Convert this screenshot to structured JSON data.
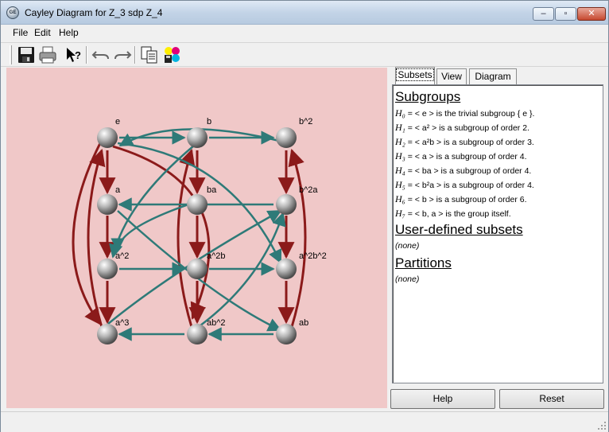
{
  "window": {
    "title": "Cayley Diagram for Z_3 sdp Z_4"
  },
  "menu": {
    "file": "File",
    "edit": "Edit",
    "help": "Help"
  },
  "toolbar": [
    "save-icon",
    "print-icon",
    "whats-this-icon",
    "undo-icon",
    "redo-icon",
    "copy-icon",
    "color-icon"
  ],
  "diagram": {
    "nodes": [
      {
        "id": "e",
        "label": "e"
      },
      {
        "id": "b",
        "label": "b"
      },
      {
        "id": "b2",
        "label": "b^2"
      },
      {
        "id": "a",
        "label": "a"
      },
      {
        "id": "ba",
        "label": "ba"
      },
      {
        "id": "b2a",
        "label": "b^2a"
      },
      {
        "id": "a2",
        "label": "a^2"
      },
      {
        "id": "a2b",
        "label": "a^2b"
      },
      {
        "id": "a2b2",
        "label": "a^2b^2"
      },
      {
        "id": "a3",
        "label": "a^3"
      },
      {
        "id": "ab2",
        "label": "ab^2"
      },
      {
        "id": "ab",
        "label": "ab"
      }
    ],
    "colors": {
      "a_arrows": "#8b1a1a",
      "b_arrows": "#2e7a78",
      "background": "#f0c8c8"
    }
  },
  "tabs": {
    "subsets": "Subsets",
    "view": "View",
    "diagram": "Diagram"
  },
  "panel": {
    "subgroups_heading": "Subgroups",
    "subgroups": [
      {
        "name": "H₀",
        "text": " = < e > is the trivial subgroup { e }."
      },
      {
        "name": "H₁",
        "text": " = < a² > is a subgroup of order 2."
      },
      {
        "name": "H₂",
        "text": " = < a²b > is a subgroup of order 3."
      },
      {
        "name": "H₃",
        "text": " = < a > is a subgroup of order 4."
      },
      {
        "name": "H₄",
        "text": " = < ba > is a subgroup of order 4."
      },
      {
        "name": "H₅",
        "text": " = < b²a > is a subgroup of order 4."
      },
      {
        "name": "H₆",
        "text": " = < b > is a subgroup of order 6."
      },
      {
        "name": "H₇",
        "text": " = < b, a > is the group itself."
      }
    ],
    "user_heading": "User-defined subsets",
    "user_none": "(none)",
    "partitions_heading": "Partitions",
    "partitions_none": "(none)"
  },
  "buttons": {
    "help": "Help",
    "reset": "Reset"
  }
}
